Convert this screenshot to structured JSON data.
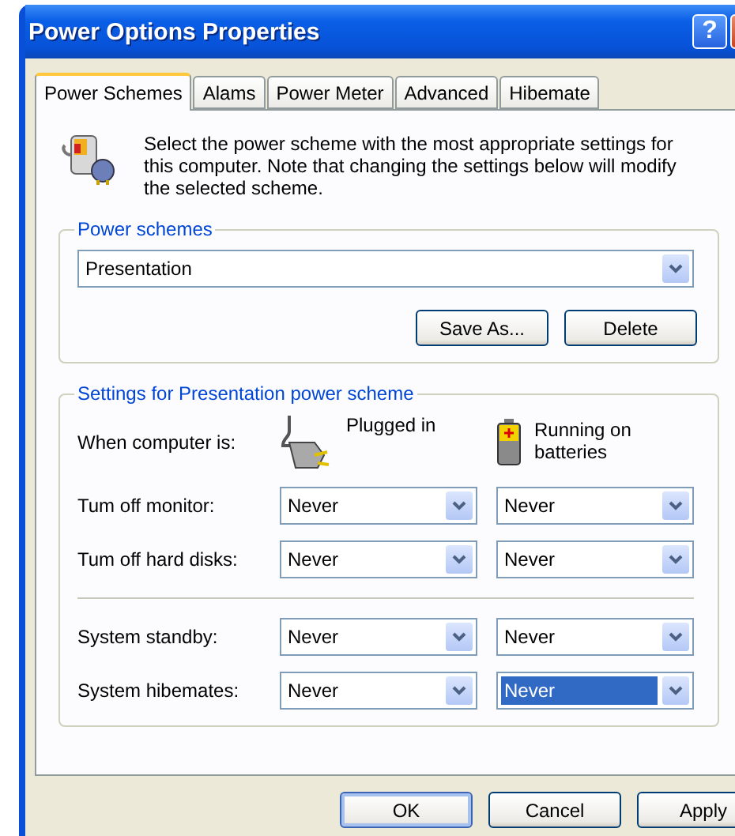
{
  "window": {
    "title": "Power Options Properties",
    "help_button": "?"
  },
  "tabs": [
    {
      "label": "Power Schemes",
      "selected": true
    },
    {
      "label": "Alams",
      "selected": false
    },
    {
      "label": "Power Meter",
      "selected": false
    },
    {
      "label": "Advanced",
      "selected": false
    },
    {
      "label": "Hibemate",
      "selected": false
    }
  ],
  "description": "Select the power scheme with the most appropriate settings for this computer. Note that changing the settings below will modify the selected scheme.",
  "power_schemes": {
    "title": "Power schemes",
    "dropdown": {
      "value": "Presentation"
    },
    "buttons": [
      "Save As...",
      "Delete"
    ]
  },
  "settings": {
    "title": "Settings for Presentation power scheme",
    "header_label": "When computer is:",
    "columns": [
      {
        "kind": "plug",
        "label": "Plugged in"
      },
      {
        "kind": "battery",
        "label": "Running on batteries"
      }
    ],
    "row_groups": [
      [
        {
          "label": "Tum off monitor:",
          "values": [
            {
              "value": "Never",
              "focused": false
            },
            {
              "value": "Never",
              "focused": false
            }
          ]
        },
        {
          "label": "Tum off hard disks:",
          "values": [
            {
              "value": "Never",
              "focused": false
            },
            {
              "value": "Never",
              "focused": false
            }
          ]
        }
      ],
      [
        {
          "label": "System standby:",
          "values": [
            {
              "value": "Never",
              "focused": false
            },
            {
              "value": "Never",
              "focused": false
            }
          ]
        },
        {
          "label": "System hibemates:",
          "values": [
            {
              "value": "Never",
              "focused": false
            },
            {
              "value": "Never",
              "focused": true
            }
          ]
        }
      ]
    ]
  },
  "footer_buttons": [
    {
      "label": "OK",
      "default": true
    },
    {
      "label": "Cancel",
      "default": false
    },
    {
      "label": "Apply",
      "default": false
    }
  ]
}
